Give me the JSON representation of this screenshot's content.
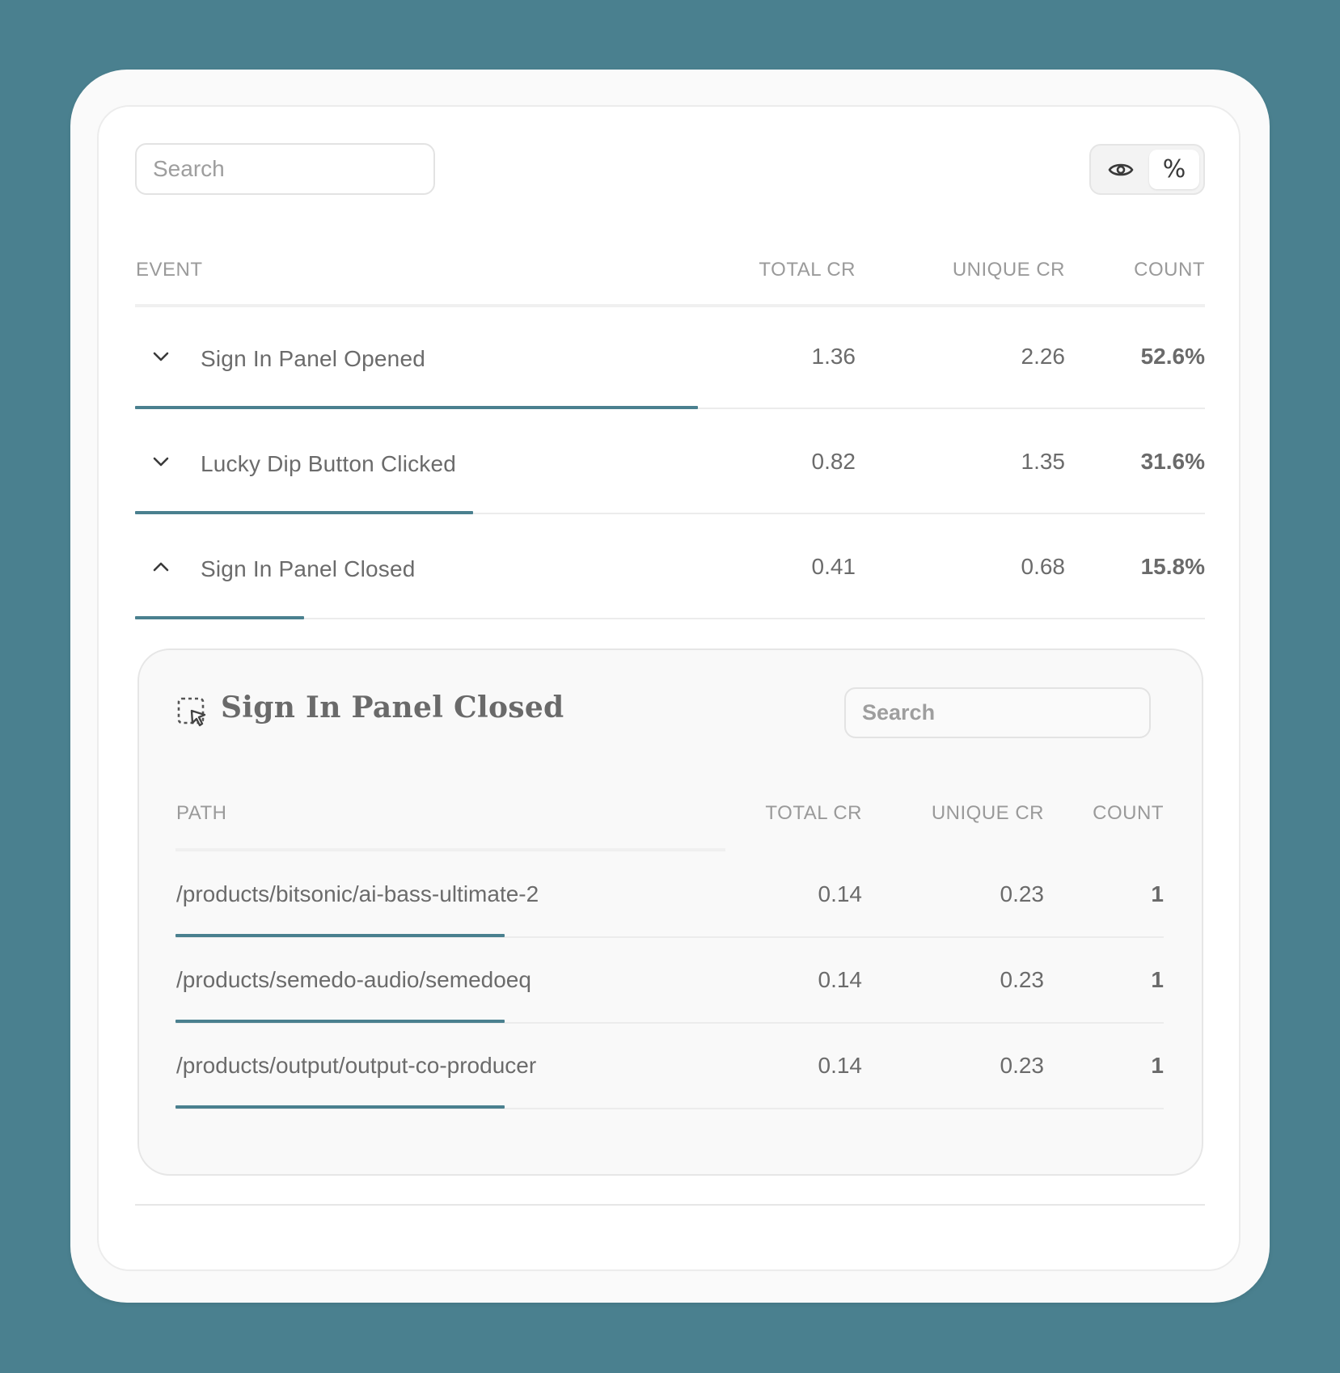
{
  "search": {
    "placeholder": "Search"
  },
  "toggles": {
    "view_icon": "eye-icon",
    "percent_label": "%"
  },
  "events_table": {
    "headers": {
      "event": "EVENT",
      "total_cr": "TOTAL CR",
      "unique_cr": "UNIQUE CR",
      "count": "COUNT"
    },
    "rows": [
      {
        "name": "Sign In Panel Opened",
        "total_cr": "1.36",
        "unique_cr": "2.26",
        "count": "52.6%",
        "share": 52.6,
        "expanded": false
      },
      {
        "name": "Lucky Dip Button Clicked",
        "total_cr": "0.82",
        "unique_cr": "1.35",
        "count": "31.6%",
        "share": 31.6,
        "expanded": false
      },
      {
        "name": "Sign In Panel Closed",
        "total_cr": "0.41",
        "unique_cr": "0.68",
        "count": "15.8%",
        "share": 15.8,
        "expanded": true
      }
    ]
  },
  "detail": {
    "title": "Sign In Panel Closed",
    "icon": "dashed-cursor-select-icon",
    "search_placeholder": "Search",
    "headers": {
      "path": "PATH",
      "total_cr": "TOTAL CR",
      "unique_cr": "UNIQUE CR",
      "count": "COUNT"
    },
    "rows": [
      {
        "path": "/products/bitsonic/ai-bass-ultimate-2",
        "total_cr": "0.14",
        "unique_cr": "0.23",
        "count": "1",
        "share": 33.3
      },
      {
        "path": "/products/semedo-audio/semedoeq",
        "total_cr": "0.14",
        "unique_cr": "0.23",
        "count": "1",
        "share": 33.3
      },
      {
        "path": "/products/output/output-co-producer",
        "total_cr": "0.14",
        "unique_cr": "0.23",
        "count": "1",
        "share": 33.3
      }
    ]
  },
  "colors": {
    "background": "#4a808f",
    "accent_bar": "#4a808f"
  }
}
